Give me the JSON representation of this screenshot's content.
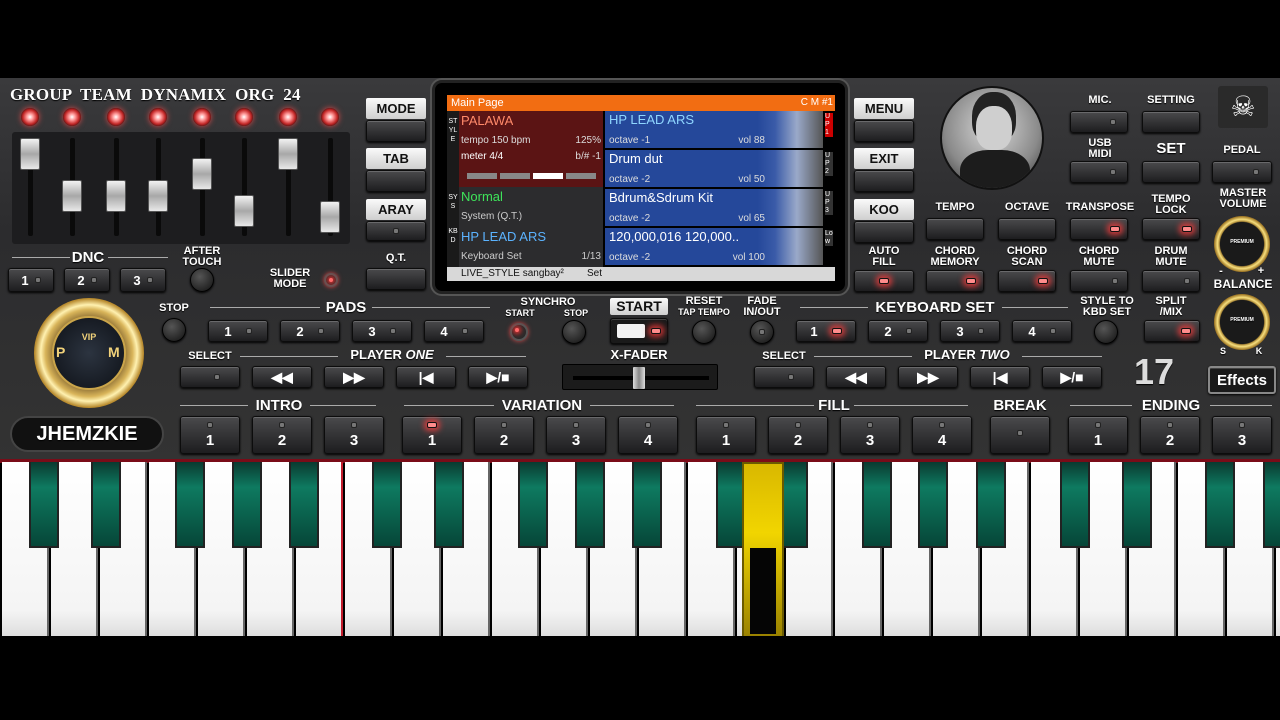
{
  "brand": {
    "title": "GROUP  TEAM  DYNAMIX  ORG  24",
    "user": "JHEMZKIE",
    "vip_text": "VIP",
    "p_letter": "P",
    "m_letter": "M"
  },
  "left": {
    "dnc": "DNC",
    "dnc_buttons": [
      "1",
      "2",
      "3"
    ],
    "after_touch": "AFTER\nTOUCH",
    "slider_mode": "SLIDER\nMODE",
    "slider_levels": [
      1.0,
      0.4,
      0.4,
      0.4,
      0.72,
      0.18,
      1.0,
      0.1
    ]
  },
  "mode_buttons": {
    "mode": "MODE",
    "tab": "TAB",
    "aray": "ARAY",
    "qt": "Q.T."
  },
  "screen": {
    "header": "Main Page",
    "header_right": "C M #1",
    "style_name": "PALAWA",
    "style_tempo": "tempo 150 bpm",
    "style_percent": "125%",
    "style_meter": "meter 4/4",
    "style_bsharp": "b/# -1",
    "sys_name": "Normal",
    "sys_sub": "System (Q.T.)",
    "kbd_name": "HP LEAD ARS",
    "kbd_sub": "Keyboard Set",
    "kbd_count": "1/13",
    "side_style": "STYLE",
    "side_sys": "SYS",
    "side_kbd": "KBD",
    "voices": [
      {
        "name": "HP LEAD ARS",
        "octave": "octave -1",
        "vol": "vol 88",
        "tag": "UP1"
      },
      {
        "name": "Drum dut",
        "octave": "octave -2",
        "vol": "vol 50",
        "tag": "UP2"
      },
      {
        "name": "Bdrum&Sdrum Kit",
        "octave": "octave -2",
        "vol": "vol 65",
        "tag": "UP3"
      },
      {
        "name": "120,000,016 120,000..",
        "octave": "octave -2",
        "vol": "vol 100",
        "tag": "Low"
      }
    ],
    "footer": "LIVE_STYLE sangbay²",
    "footer_set": "Set"
  },
  "right_top": {
    "menu": "MENU",
    "exit": "EXIT",
    "koo": "KOO",
    "auto_fill": "AUTO\nFILL",
    "tempo": "TEMPO",
    "octave": "OCTAVE",
    "transpose": "TRANSPOSE",
    "tempo_lock": "TEMPO\nLOCK",
    "chord_memory": "CHORD\nMEMORY",
    "chord_scan": "CHORD\nSCAN",
    "chord_mute": "CHORD\nMUTE",
    "drum_mute": "DRUM\nMUTE",
    "mic": "MIC.",
    "setting": "SETTING",
    "usb_midi": "USB\nMIDI",
    "set": "SET",
    "pedal": "PEDAL",
    "master_volume": "MASTER\nVOLUME",
    "balance": "BALANCE",
    "minus": "-",
    "plus": "+",
    "s": "S",
    "k": "K",
    "premium": "PREMIUM"
  },
  "transport": {
    "stop": "STOP",
    "pads": "PADS",
    "pad_numbers": [
      "1",
      "2",
      "3",
      "4"
    ],
    "synchro": "SYNCHRO",
    "synchro_start": "START",
    "synchro_stop": "STOP",
    "start": "START",
    "reset": "RESET",
    "tap_tempo": "TAP TEMPO",
    "fade": "FADE\nIN/OUT",
    "keyboard_set": "KEYBOARD SET",
    "kbd_numbers": [
      "1",
      "2",
      "3",
      "4"
    ],
    "style_to_kbd": "STYLE TO\nKBD SET",
    "split_mix": "SPLIT\n/MIX"
  },
  "players": {
    "select": "SELECT",
    "player_one": "PLAYER ",
    "player_one_em": "ONE",
    "player_two": "PLAYER ",
    "player_two_em": "TWO",
    "xfader": "X-FADER",
    "count": "17",
    "effects": "Effects"
  },
  "sections": {
    "intro": "INTRO",
    "intro_buttons": [
      "1",
      "2",
      "3"
    ],
    "variation": "VARIATION",
    "variation_buttons": [
      "1",
      "2",
      "3",
      "4"
    ],
    "fill": "FILL",
    "fill_buttons": [
      "1",
      "2",
      "3",
      "4"
    ],
    "break": "BREAK",
    "ending": "ENDING",
    "ending_buttons": [
      "1",
      "2",
      "3"
    ]
  },
  "colors": {
    "accent_orange": "#f26d12",
    "voice_blue": "#25489a",
    "style_red": "#5b1414",
    "active_key": "#e8c400"
  }
}
